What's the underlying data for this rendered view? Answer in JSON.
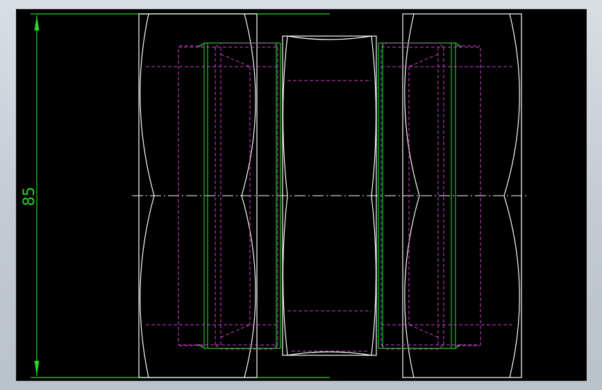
{
  "drawing": {
    "dimension_label": "85",
    "colors": {
      "background": "#000000",
      "outline": "#ffffff",
      "dimension": "#28d428",
      "hidden": "#d040d0",
      "edge_green": "#22c422"
    }
  }
}
